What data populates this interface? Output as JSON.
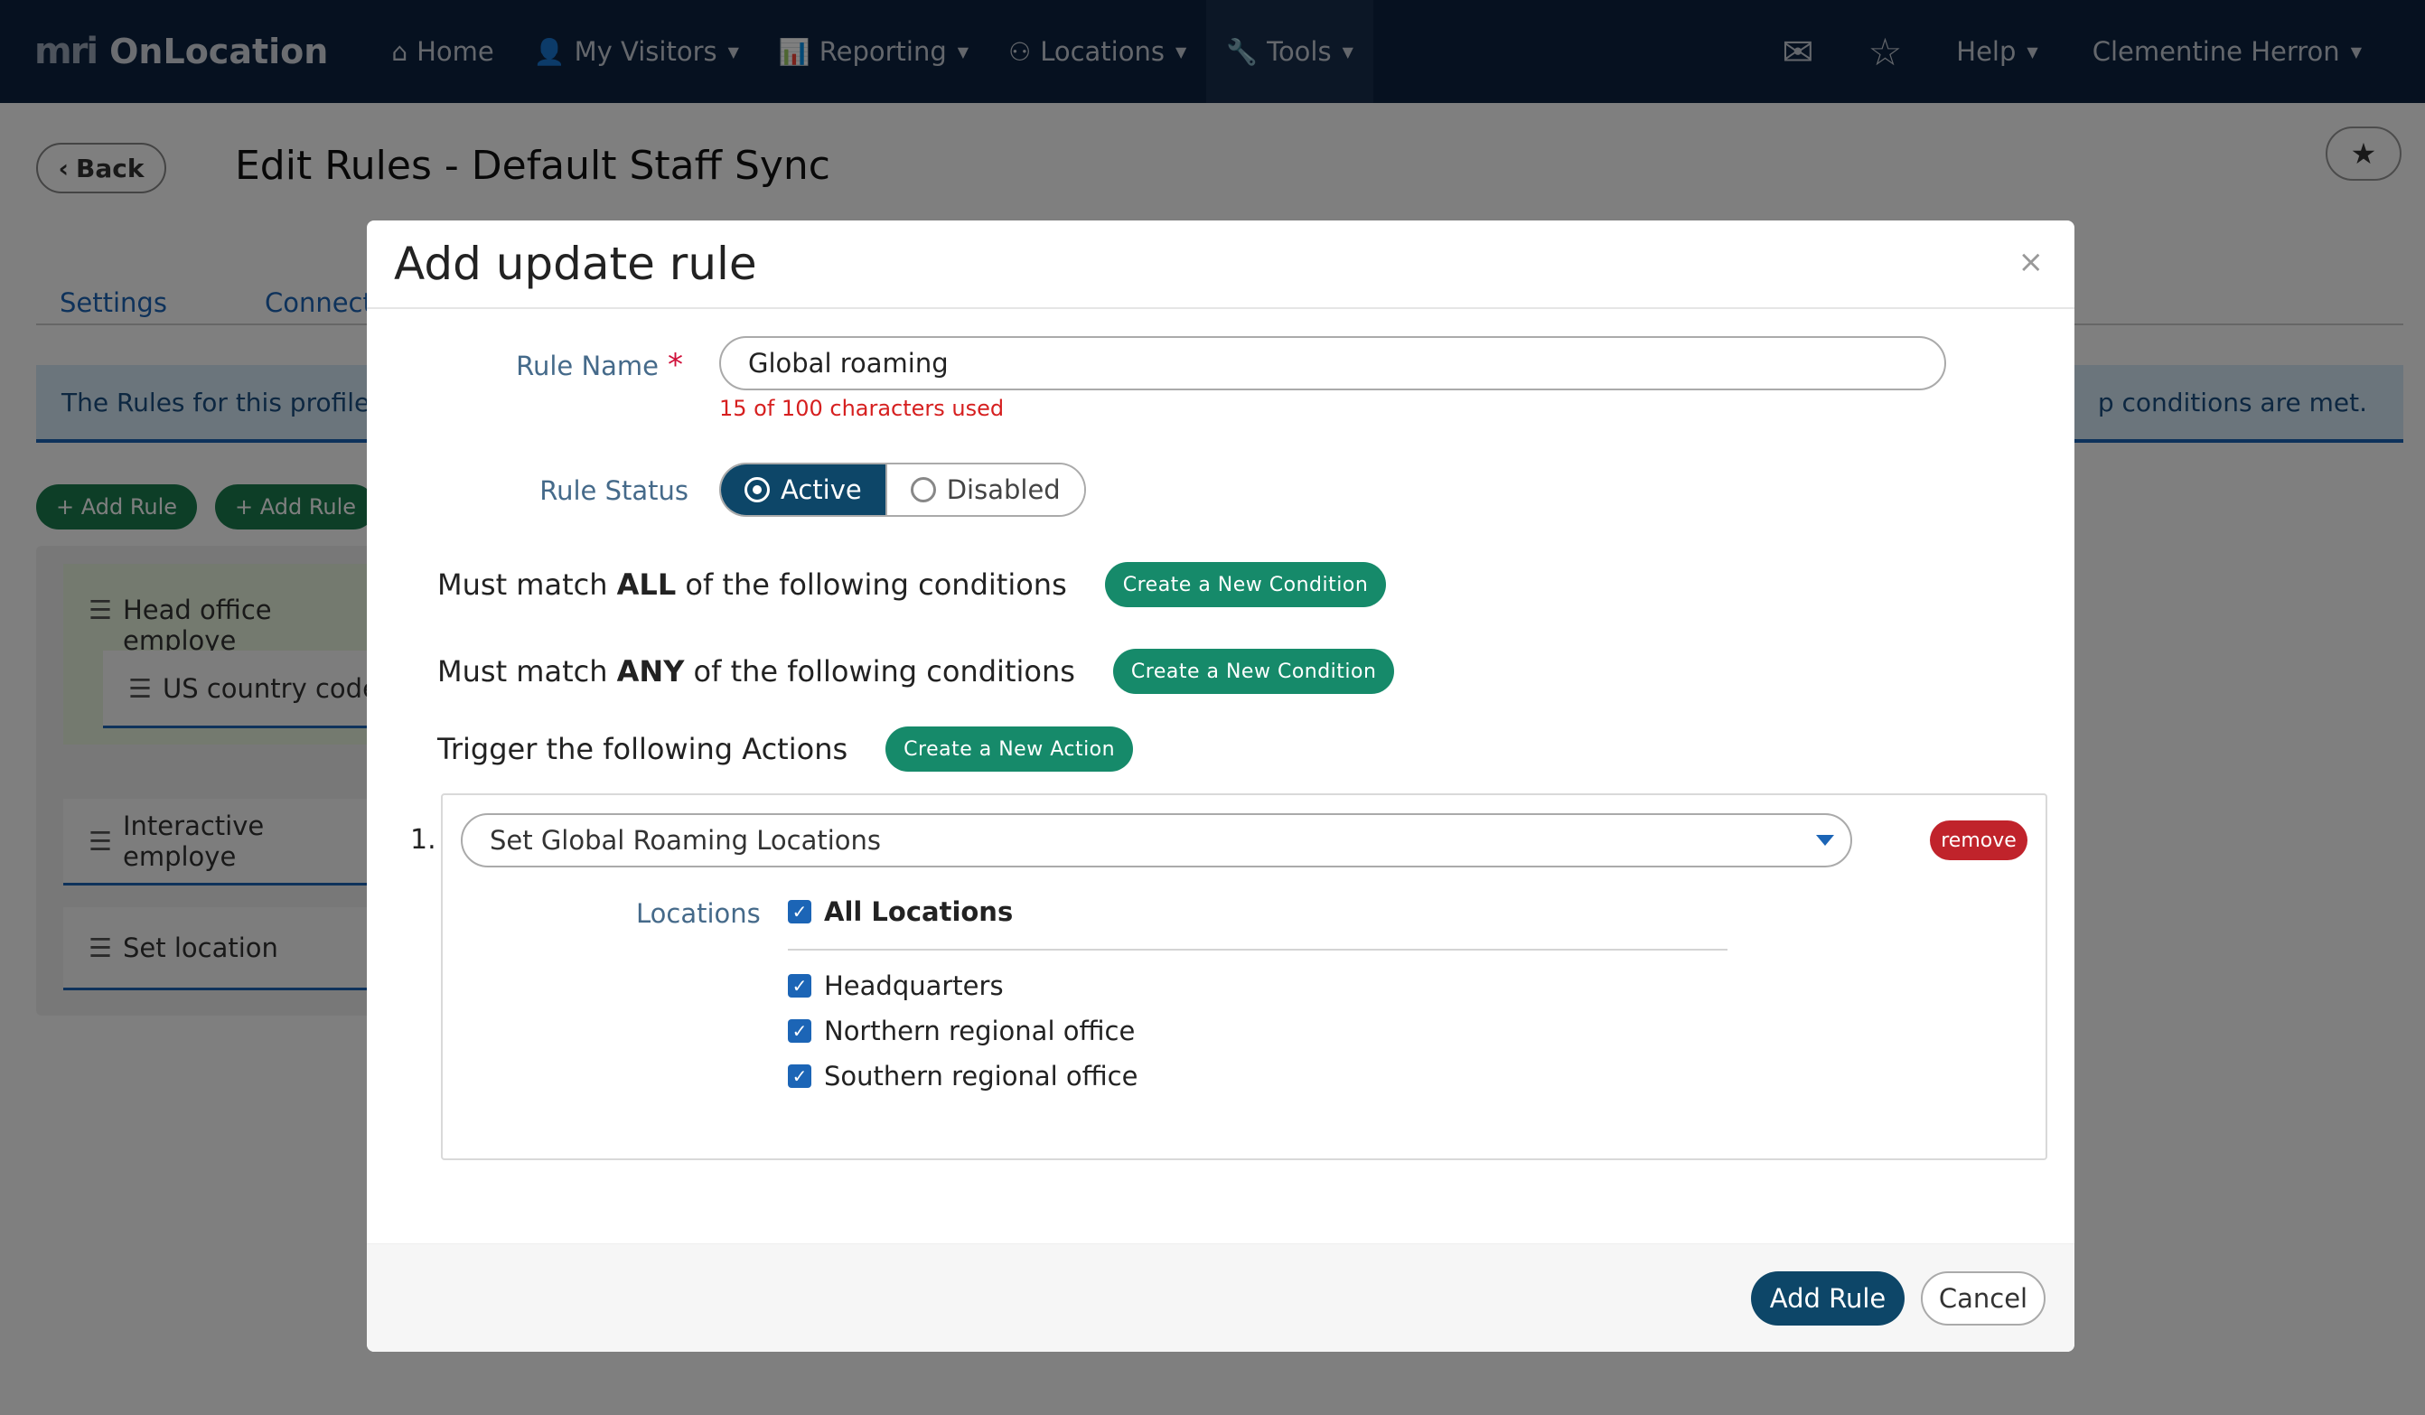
{
  "nav": {
    "logo_mark": "mri",
    "logo_text": "OnLocation",
    "items": [
      {
        "icon": "home-icon",
        "glyph": "⌂",
        "label": "Home",
        "caret": false
      },
      {
        "icon": "user-icon",
        "glyph": "👤",
        "label": "My Visitors",
        "caret": true
      },
      {
        "icon": "bar-chart-icon",
        "glyph": "📊",
        "label": "Reporting",
        "caret": true
      },
      {
        "icon": "network-icon",
        "glyph": "⚇",
        "label": "Locations",
        "caret": true
      },
      {
        "icon": "wrench-icon",
        "glyph": "🔧",
        "label": "Tools",
        "caret": true
      }
    ],
    "help": "Help",
    "user": "Clementine Herron"
  },
  "page": {
    "back": "Back",
    "title": "Edit Rules - Default Staff Sync",
    "tabs": [
      "Settings",
      "Connectors"
    ],
    "info_left": "The Rules for this profile a",
    "info_right": "p conditions are met.",
    "add_rule_1": "+ Add Rule",
    "add_rule_2": "+ Add Rule",
    "rules": [
      "Head office employe",
      "US country code",
      "Interactive employe",
      "Set location"
    ]
  },
  "modal": {
    "title": "Add update rule",
    "close": "×",
    "rule_name_label": "Rule Name",
    "required_mark": "*",
    "rule_name_value": "Global roaming",
    "char_count": "15 of 100 characters used",
    "rule_status_label": "Rule Status",
    "status_active": "Active",
    "status_disabled": "Disabled",
    "match_all_pre": "Must match ",
    "match_all_bold": "ALL",
    "match_all_post": " of the following conditions",
    "match_any_pre": "Must match ",
    "match_any_bold": "ANY",
    "match_any_post": " of the following conditions",
    "create_condition": "Create a New Condition",
    "actions_label": "Trigger the following Actions",
    "create_action": "Create a New Action",
    "action_number": "1.",
    "action_select": "Set Global Roaming Locations",
    "remove": "remove",
    "locations_label": "Locations",
    "all_locations": "All Locations",
    "locations": [
      "Headquarters",
      "Northern regional office",
      "Southern regional office"
    ],
    "add_rule": "Add Rule",
    "cancel": "Cancel"
  }
}
